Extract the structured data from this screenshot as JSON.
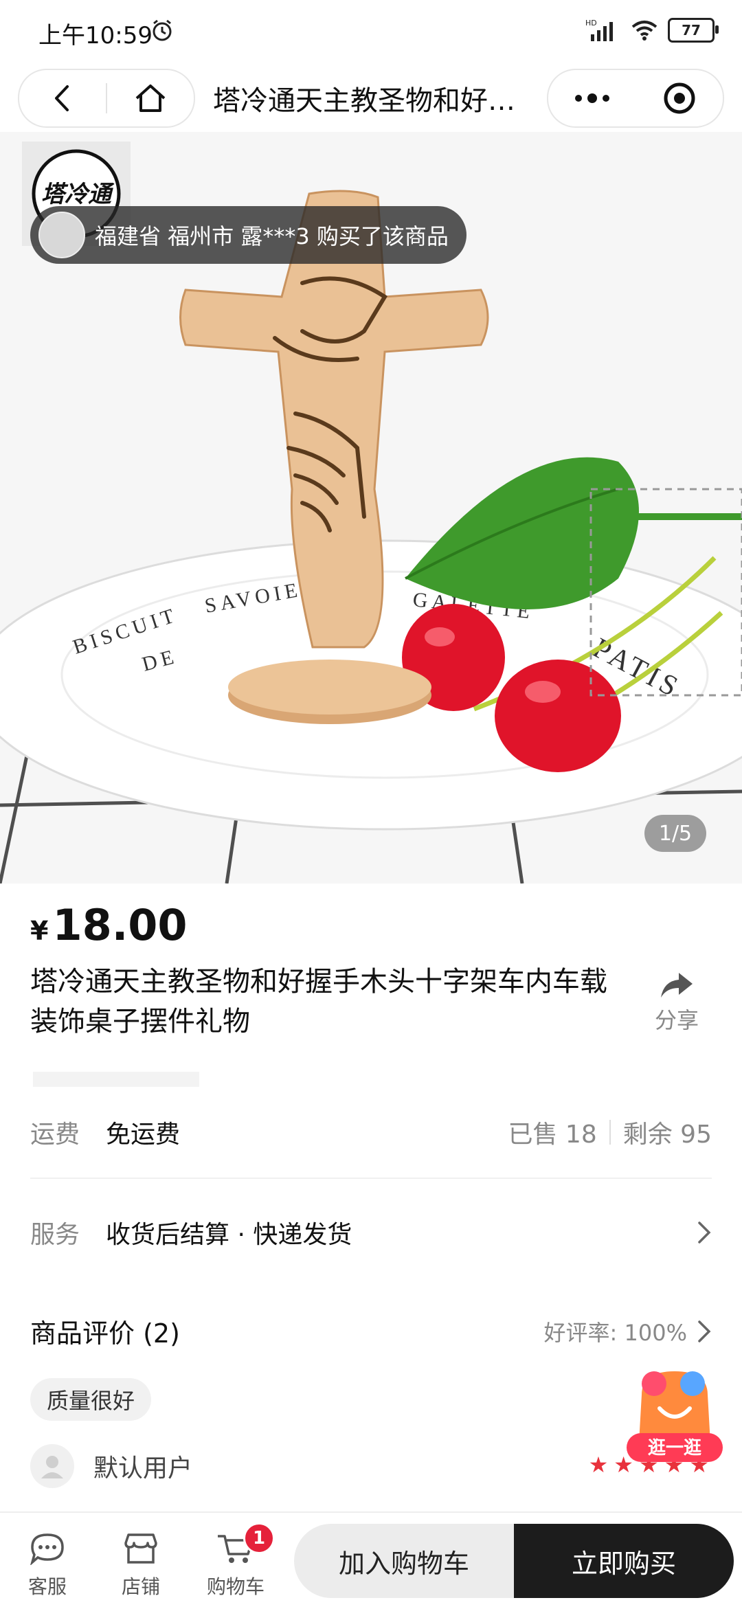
{
  "status_bar": {
    "time": "上午10:59",
    "network": "HD",
    "battery": "77"
  },
  "nav": {
    "title": "塔冷通天主教圣物和好握手木头十字架车内车载装饰桌子摆件礼物"
  },
  "gallery": {
    "shop_logo_text": "塔冷通",
    "purchase_notice": "福建省 福州市 露***3 购买了该商品",
    "counter": "1/5",
    "plate_texts": [
      "BISCUIT",
      "SAVOIE",
      "DE",
      "GALETTE",
      "PATIS"
    ]
  },
  "product": {
    "currency": "¥",
    "price": "18.00",
    "title": "塔冷通天主教圣物和好握手木头十字架车内车载装饰桌子摆件礼物",
    "share_label": "分享"
  },
  "shipping": {
    "label": "运费",
    "value": "免运费",
    "sold": "已售 18",
    "remaining": "剩余 95"
  },
  "service": {
    "label": "服务",
    "value": "收货后结算 · 快递发货"
  },
  "reviews": {
    "title": "商品评价 (2)",
    "rate": "好评率: 100%",
    "tag": "质量很好",
    "user": "默认用户",
    "stars": 5
  },
  "promo": {
    "label": "逛一逛"
  },
  "bottom_bar": {
    "service_label": "客服",
    "store_label": "店铺",
    "cart_label": "购物车",
    "cart_badge": "1",
    "add_to_cart": "加入购物车",
    "buy_now": "立即购买"
  },
  "colors": {
    "accent_red": "#e5213a",
    "buy_button": "#1c1c1c",
    "star": "#e8323c"
  }
}
